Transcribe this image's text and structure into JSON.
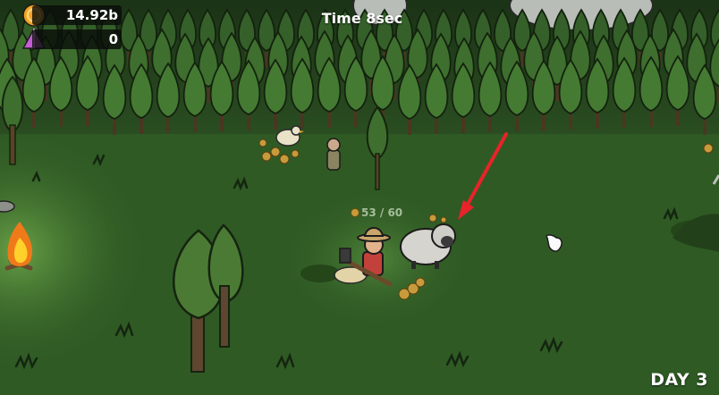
{
  "hud": {
    "coins": "14.92b",
    "gems": "0",
    "timer": "Time 8sec",
    "day": "DAY 3",
    "sheep_hp": "53 / 60"
  },
  "icons": [
    "coin-icon",
    "gem-icon",
    "campfire-icon",
    "pointer-arrow-icon",
    "cursor-hand-icon"
  ],
  "colors": {
    "grass": "#2f5a24",
    "forest": "#223f1c",
    "coin": "#f2a321",
    "gem": "#c65cd6",
    "arrow": "#e8232a"
  }
}
